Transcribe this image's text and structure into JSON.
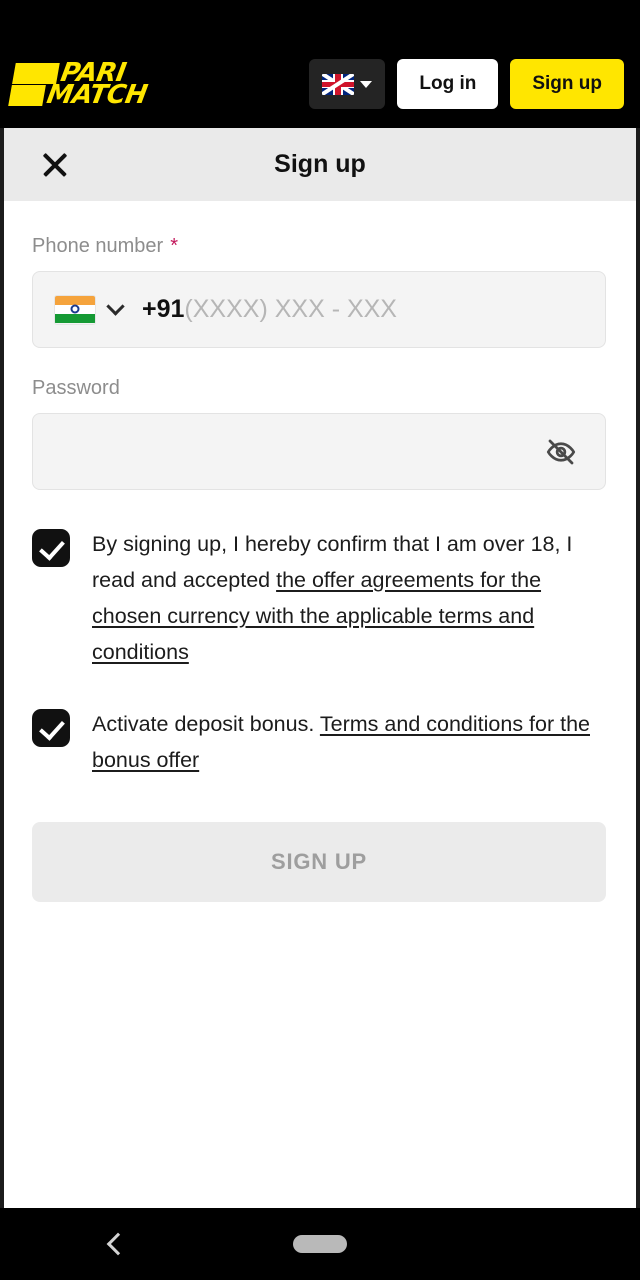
{
  "brand": {
    "logo_line1": "PARI",
    "logo_line2": "MATCH",
    "accent_color": "#ffe600"
  },
  "header": {
    "language_flag": "uk-flag-icon",
    "language_caret": "caret-down-icon",
    "login_label": "Log in",
    "signup_label": "Sign up"
  },
  "modal": {
    "close_icon": "close-icon",
    "title": "Sign up"
  },
  "form": {
    "phone": {
      "label": "Phone number",
      "required_marker": "*",
      "country_flag": "india-flag-icon",
      "country_caret": "chevron-down-icon",
      "dial_code": "+91",
      "placeholder": "(XXXX) XXX - XXX",
      "value": ""
    },
    "password": {
      "label": "Password",
      "value": "",
      "placeholder": "",
      "toggle_icon": "eye-off-icon"
    },
    "terms_checkbox": {
      "checked": true,
      "text_before": "By signing up, I hereby confirm that I am over 18, I read and accepted ",
      "link_text": "the offer agreements for the chosen currency with the applicable terms and conditions"
    },
    "bonus_checkbox": {
      "checked": true,
      "text_before": "Activate deposit bonus. ",
      "link_text": "Terms and conditions for the bonus offer"
    },
    "submit_label": "SIGN UP",
    "submit_enabled": false
  },
  "navbar": {
    "back_icon": "back-chevron-icon",
    "home_icon": "home-pill-icon"
  }
}
